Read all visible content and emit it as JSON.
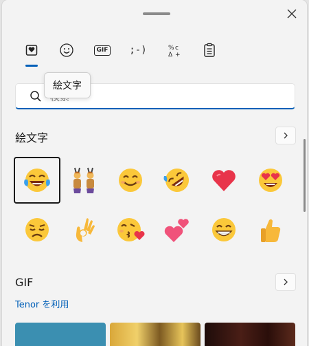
{
  "tabs": [
    {
      "name": "emoji"
    },
    {
      "name": "kaomoji-face"
    },
    {
      "name": "gif",
      "label": "GIF"
    },
    {
      "name": "kaomoji",
      "label": ";-)"
    },
    {
      "name": "symbols",
      "label": "%ᶜ\nΔ+"
    },
    {
      "name": "clipboard"
    }
  ],
  "tooltip": "絵文字",
  "search": {
    "placeholder": "検索"
  },
  "emoji_section": {
    "title": "絵文字",
    "items": [
      {
        "name": "face-with-tears-of-joy",
        "selected": true
      },
      {
        "name": "people-with-bunny-ears"
      },
      {
        "name": "smiling-face"
      },
      {
        "name": "rolling-on-the-floor-laughing"
      },
      {
        "name": "red-heart"
      },
      {
        "name": "smiling-face-with-heart-eyes"
      },
      {
        "name": "disappointed-face"
      },
      {
        "name": "ok-hand"
      },
      {
        "name": "face-blowing-a-kiss"
      },
      {
        "name": "two-hearts"
      },
      {
        "name": "beaming-face"
      },
      {
        "name": "thumbs-up"
      }
    ]
  },
  "gif_section": {
    "title": "GIF",
    "provider_link": "Tenor を利用"
  },
  "colors": {
    "accent": "#005fb8",
    "panel": "#f3f3f3"
  }
}
